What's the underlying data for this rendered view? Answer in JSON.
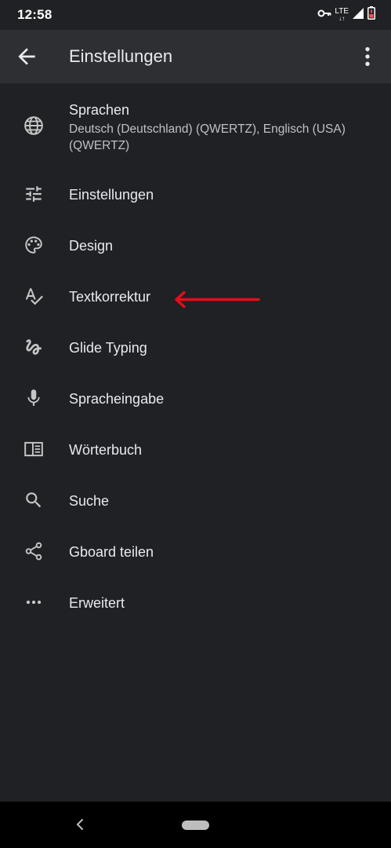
{
  "status_bar": {
    "time": "12:58",
    "network_label": "LTE",
    "icons": [
      "vpn-key-icon",
      "lte-icon",
      "signal-icon",
      "battery-low-icon"
    ]
  },
  "app_bar": {
    "title": "Einstellungen",
    "back_icon": "arrow-back-icon",
    "overflow_icon": "more-vert-icon"
  },
  "menu": {
    "items": [
      {
        "label": "Sprachen",
        "sublabel": "Deutsch (Deutschland) (QWERTZ), Englisch (USA) (QWERTZ)",
        "icon": "globe-icon"
      },
      {
        "label": "Einstellungen",
        "icon": "tune-icon"
      },
      {
        "label": "Design",
        "icon": "palette-icon"
      },
      {
        "label": "Textkorrektur",
        "icon": "spellcheck-icon"
      },
      {
        "label": "Glide Typing",
        "icon": "gesture-icon"
      },
      {
        "label": "Spracheingabe",
        "icon": "mic-icon"
      },
      {
        "label": "Wörterbuch",
        "icon": "dictionary-icon"
      },
      {
        "label": "Suche",
        "icon": "search-icon"
      },
      {
        "label": "Gboard teilen",
        "icon": "share-icon"
      },
      {
        "label": "Erweitert",
        "icon": "more-horiz-icon"
      }
    ]
  },
  "annotation": {
    "color": "#e0101a",
    "points_to": "Textkorrektur"
  },
  "colors": {
    "background": "#202124",
    "app_bar": "#2e2f32",
    "text": "#e8eaed",
    "secondary_text": "#bdc1c6",
    "icon": "#c4c7c5"
  }
}
